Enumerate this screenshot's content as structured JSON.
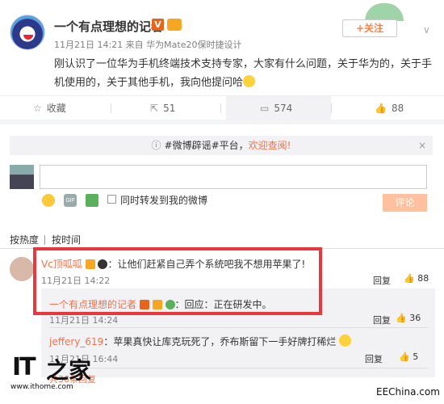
{
  "post": {
    "username": "一个有点理想的记者",
    "v_badge": "V",
    "meta": "11月21日 14:21 来自 华为Mate20保时捷设计",
    "text": "刚认识了一位华为手机终端技术支持专家，大家有什么问题，关于华为的，关于手机使用的，关于其他手机，我向他提问哈",
    "follow_label": "+关注"
  },
  "actions": {
    "favorite": "收藏",
    "repost": "51",
    "comment": "574",
    "like": "88"
  },
  "notice": {
    "prefix": "#微博辟谣#平台，",
    "link": "欢迎查阅!",
    "close": "×"
  },
  "composer": {
    "also_repost": "同时转发到我的微博",
    "submit": "评论"
  },
  "sort": {
    "hot": "按热度",
    "time": "按时间"
  },
  "comments": [
    {
      "user": "Vc顶呱呱",
      "text": "：让他们赶紧自己弄个系统吧我不想用苹果了!",
      "time": "11月21日 14:22",
      "reply": "回复",
      "likes": "88"
    }
  ],
  "replies": [
    {
      "user": "一个有点理想的记者",
      "v_badge": "V",
      "text": "：回应：正在研发中。",
      "time": "11月21日 14:24",
      "reply": "回复",
      "likes": "36"
    },
    {
      "user": "jeffery_619",
      "text": "：苹果真快让库克玩死了，乔布斯留下一手好牌打稀烂",
      "time": "11月21日 16:44",
      "reply": "回复",
      "likes": "5"
    }
  ],
  "more_replies": "共36条回复",
  "watermark": {
    "it": "IT",
    "zh": "之家",
    "url": "www.ithome.com",
    "right": "EEChina.com"
  },
  "icons": [
    "star-icon",
    "repost-icon",
    "comment-icon",
    "thumb-icon",
    "info-icon",
    "smile-icon",
    "gif-icon",
    "image-icon"
  ],
  "colors": {
    "accent": "#eb7350",
    "highlight": "#e8383d",
    "v_badge": "#e8641b"
  }
}
